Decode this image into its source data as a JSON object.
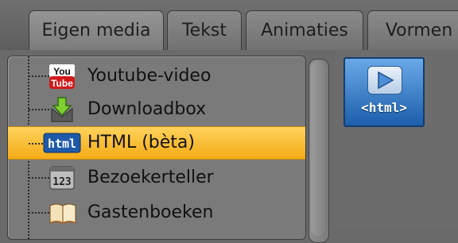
{
  "tabs": [
    {
      "label": "Eigen media",
      "active": true
    },
    {
      "label": "Tekst",
      "active": false
    },
    {
      "label": "Animaties",
      "active": false
    },
    {
      "label": "Vormen",
      "active": false
    }
  ],
  "list": {
    "items": [
      {
        "label": "Youtube-video",
        "icon": "youtube-icon",
        "selected": false
      },
      {
        "label": "Downloadbox",
        "icon": "download-icon",
        "selected": false
      },
      {
        "label": "HTML (bèta)",
        "icon": "html-icon",
        "selected": true
      },
      {
        "label": "Bezoekerteller",
        "icon": "counter-icon",
        "selected": false
      },
      {
        "label": "Gastenboeken",
        "icon": "book-icon",
        "selected": false
      }
    ]
  },
  "preview": {
    "tile_label": "<html>",
    "icon": "html-play-icon"
  },
  "icons": {
    "youtube_top": "You",
    "youtube_bottom": "Tube",
    "html_badge": "html",
    "counter": "123"
  },
  "colors": {
    "selection_top": "#ffd35c",
    "selection_bottom": "#f4ab16",
    "tile_top": "#6aa9e8",
    "tile_bottom": "#1c5eab"
  }
}
